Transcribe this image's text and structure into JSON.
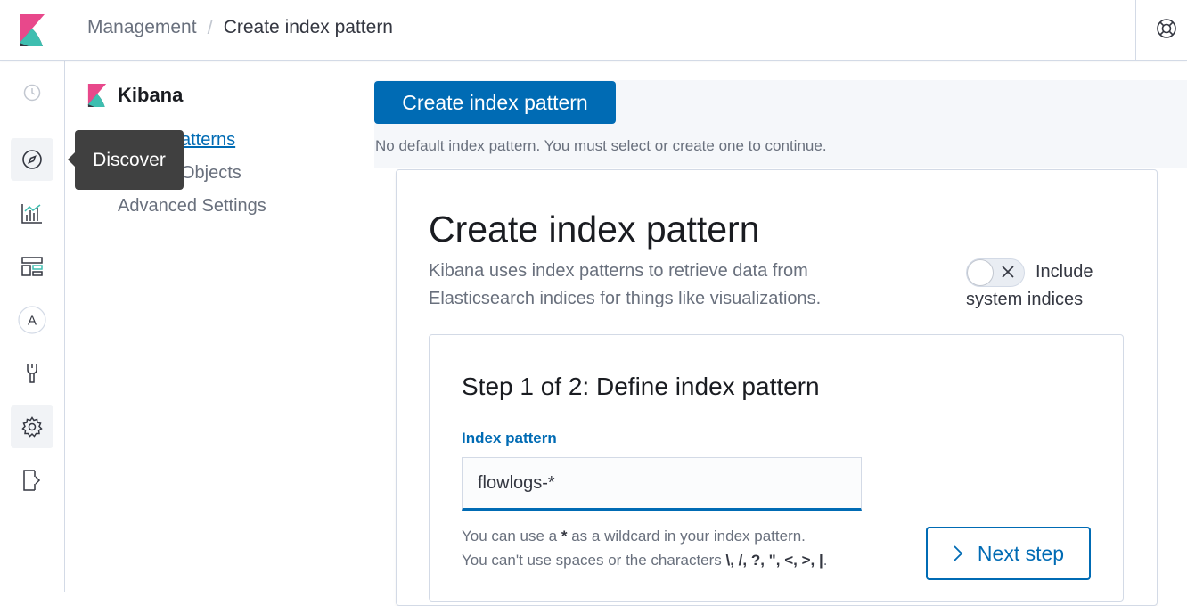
{
  "header": {
    "breadcrumb_parent": "Management",
    "breadcrumb_separator": "/",
    "breadcrumb_current": "Create index pattern",
    "help_icon": "help-lifebuoy-icon"
  },
  "nav": {
    "items": [
      {
        "name": "recently-viewed",
        "icon": "clock-icon"
      },
      {
        "name": "discover",
        "icon": "compass-icon"
      },
      {
        "name": "visualize",
        "icon": "chart-icon"
      },
      {
        "name": "dashboard",
        "icon": "dashboard-icon"
      },
      {
        "name": "apm",
        "icon": "a-icon",
        "glyph": "A"
      },
      {
        "name": "dev-tools",
        "icon": "wrench-icon"
      },
      {
        "name": "management",
        "icon": "gear-icon"
      },
      {
        "name": "collapse",
        "icon": "dock-icon"
      }
    ],
    "tooltip": "Discover"
  },
  "sidebar": {
    "title": "Kibana",
    "links": [
      {
        "label": "Index Patterns",
        "visible_label": "atterns",
        "active": true
      },
      {
        "label": "Saved Objects",
        "visible_label": "Objects",
        "active": false
      },
      {
        "label": "Advanced Settings",
        "visible_label": "Advanced Settings",
        "active": false
      }
    ]
  },
  "main": {
    "create_button": "Create index pattern",
    "notice": "No default index pattern. You must select or create one to continue.",
    "panel_title": "Create index pattern",
    "panel_description": "Kibana uses index patterns to retrieve data from Elasticsearch indices for things like visualizations.",
    "toggle_label": "Include system indices",
    "toggle_on": false,
    "step_title": "Step 1 of 2: Define index pattern",
    "field_label": "Index pattern",
    "field_value": "flowlogs-*",
    "help_line1_prefix": "You can use a ",
    "help_line1_bold": "*",
    "help_line1_suffix": " as a wildcard in your index pattern.",
    "help_line2_prefix": "You can't use spaces or the characters ",
    "help_line2_chars": "\\, /, ?, \", <, >, |",
    "help_line2_suffix": ".",
    "next_button": "Next step"
  },
  "colors": {
    "primary": "#006bb4",
    "tooltip_bg": "#404040",
    "text_subdued": "#69707d",
    "border": "#d3dae6",
    "logo_pink": "#e8488b",
    "logo_teal": "#3ebeb0",
    "logo_dark": "#343741"
  }
}
